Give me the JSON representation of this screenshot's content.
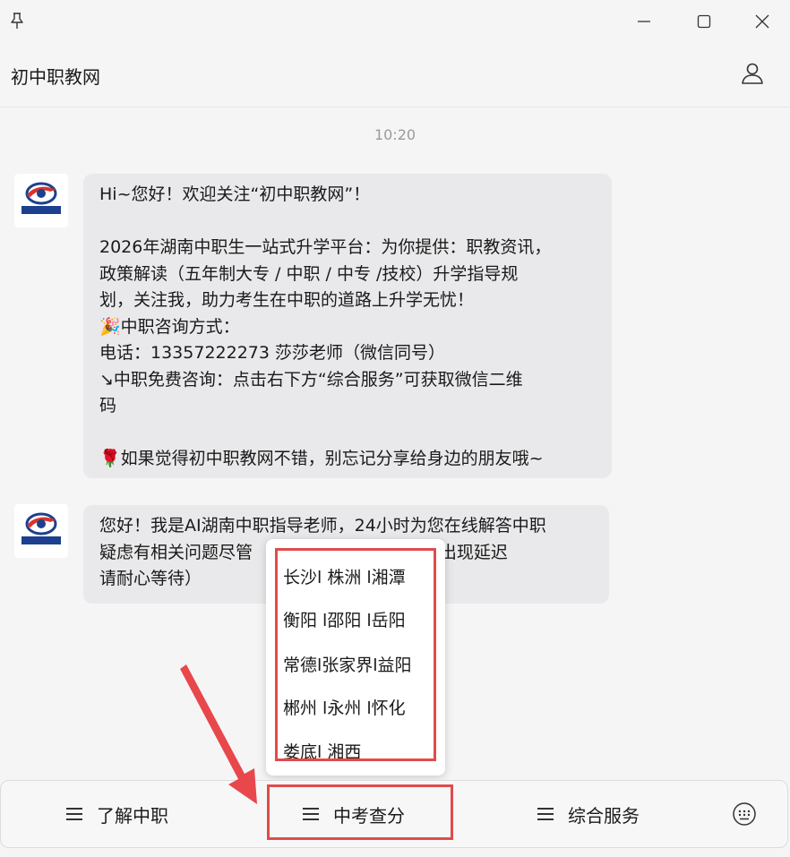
{
  "window": {
    "title": "初中职教网",
    "controls": [
      "minimize-icon",
      "maximize-icon",
      "close-icon"
    ]
  },
  "chat": {
    "time": "10:20",
    "messages": [
      {
        "sender_avatar": "初中职教网",
        "text": "Hi~您好！欢迎关注“初中职教网”！\n\n2026年湖南中职生一站式升学平台：为你提供：职教资讯，\n政策解读（五年制大专 / 中职 / 中专 /技校）升学指导规\n划，关注我，助力考生在中职的道路上升学无忧！\n🎉中职咨询方式：\n电话：13357222273 莎莎老师（微信同号）\n↘中职免费咨询：点击右下方“综合服务”可获取微信二维\n码\n\n🌹如果觉得初中职教网不错，别忘记分享给身边的朋友哦~"
      },
      {
        "sender_avatar": "初中职教网",
        "text": "您好！我是AI湖南中职指导老师，24小时为您在线解答中职\n疑虑有相关问题尽管                      过程中会出现延迟\n请耐心等待）"
      }
    ]
  },
  "popup_menu": {
    "items": [
      "长沙l 株洲 l湘潭",
      "衡阳 l邵阳 l岳阳",
      "常德l张家界l益阳",
      "郴州 l永州 l怀化",
      "娄底l 湘西"
    ]
  },
  "bottom_menu": {
    "buttons": [
      "了解中职",
      "中考查分",
      "综合服务"
    ]
  },
  "colors": {
    "highlight": "#e14b4b",
    "bubble": "#e9e9eb",
    "background": "#f5f5f5"
  }
}
